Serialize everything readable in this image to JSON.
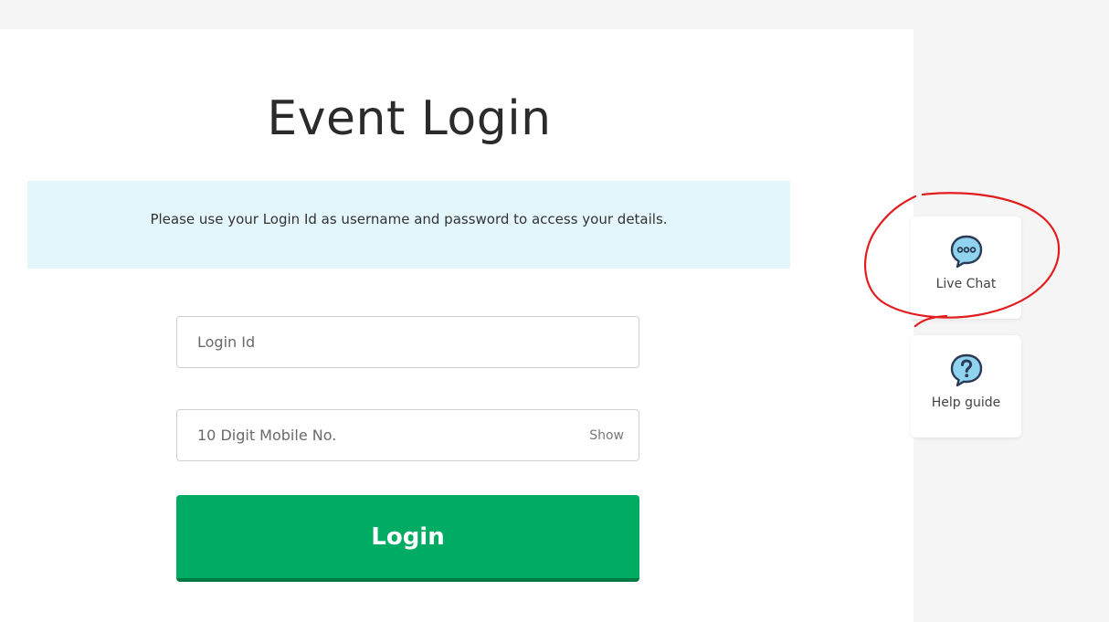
{
  "login": {
    "title": "Event Login",
    "info_message": "Please use your Login Id as username and password to access your details.",
    "login_id_placeholder": "Login Id",
    "mobile_placeholder": "10 Digit Mobile No.",
    "show_label": "Show",
    "login_button": "Login"
  },
  "side_widgets": {
    "live_chat": {
      "label": "Live Chat",
      "icon": "chat-bubble-icon"
    },
    "help_guide": {
      "label": "Help guide",
      "icon": "help-question-icon"
    }
  },
  "colors": {
    "primary_green": "#00ab63",
    "banner_bg": "#e3f6fb",
    "icon_blue": "#8fd3ee",
    "annotation_red": "#e11d1d"
  }
}
